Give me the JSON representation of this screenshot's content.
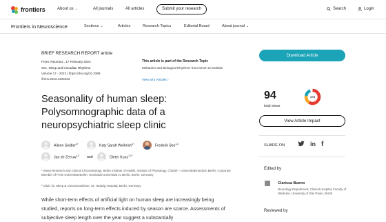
{
  "topbar": {
    "logo_text": "frontiers",
    "nav": [
      "About us",
      "All journals",
      "All articles"
    ],
    "submit_label": "Submit your research",
    "search_label": "Search",
    "login_label": "Login"
  },
  "journalbar": {
    "title": "Frontiers in Neuroscience",
    "nav": [
      "Sections",
      "Articles",
      "Research Topics",
      "Editorial Board",
      "About journal"
    ]
  },
  "article": {
    "type": "BRIEF RESEARCH REPORT article",
    "meta": [
      "Front. Neurosci., 17 February 2023",
      "Sec. Sleep and Circadian Rhythms",
      "Volume 17 - 2023 | https://doi.org/10.3389",
      "/fnins.2023.1105233"
    ],
    "research_topic_head": "This article is part of the Research Topic",
    "research_topic_name": "Melatonin and Biological Rhythms: from bench to bedside",
    "research_topic_link": "View all 4 Articles",
    "title": "Seasonality of human sleep: Polysomnographic data of a neuropsychiatric sleep clinic",
    "authors": [
      {
        "name": "Aileen Seidler",
        "sup": "1†"
      },
      {
        "name": "Katy Sarah Weihrich",
        "sup": "1†"
      },
      {
        "name": "Frederik Bes",
        "sup": "1,2"
      },
      {
        "name": "Jan de Zeeuw",
        "sup": "1,2"
      },
      {
        "name": "Dieter Kunz",
        "sup": "1,2*"
      }
    ],
    "and_word": "and",
    "affiliations": [
      "¹ Sleep Research and Clinical Chronobiology, Berlin Institute of Health, Institute of Physiology, Charité – Universitätsmedizin Berlin, Corporate Member of Freie Universität Berlin, Humboldt-Universität zu Berlin, Berlin, Germany",
      "² Clinic for Sleep & Chronomedicine, St. Hedwig Hospital, Berlin, Germany"
    ],
    "abstract": "While short-term effects of artificial light on human sleep are increasingly being studied, reports on long-term effects induced by season are scarce. Assessments of subjective sleep length over the year suggest a substantially"
  },
  "sidebar": {
    "download_label": "Download Article",
    "views_count": "94",
    "views_label": "total views",
    "altmetric_score": "163",
    "impact_label": "View Article Impact",
    "share_label": "SHARE ON",
    "share_icons": [
      "twitter-icon",
      "linkedin-icon",
      "facebook-icon"
    ],
    "edited_by_label": "Edited by",
    "editor_name": "Clarissa Bueno",
    "editor_affiliation": "Neurology Department, Clinical Hospital, Faculty of Medicine, University of São Paulo, Brazil",
    "reviewed_by_label": "Reviewed by"
  },
  "colors": {
    "accent": "#1ba3b8",
    "link": "#0b6cb8"
  }
}
